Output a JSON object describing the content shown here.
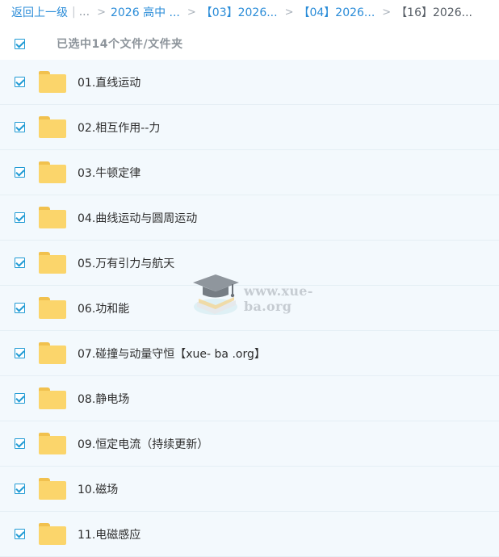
{
  "breadcrumb": {
    "back": "返回上一级",
    "ellipsis": "...",
    "items": [
      "2026 高中 ...",
      "【03】2026...",
      "【04】2026..."
    ],
    "current": "【16】2026..."
  },
  "selection": {
    "all_checked": true,
    "status_text": "已选中14个文件/文件夹"
  },
  "files": [
    {
      "name": "01.直线运动",
      "checked": true
    },
    {
      "name": "02.相互作用--力",
      "checked": true
    },
    {
      "name": "03.牛顿定律",
      "checked": true
    },
    {
      "name": "04.曲线运动与圆周运动",
      "checked": true
    },
    {
      "name": "05.万有引力与航天",
      "checked": true
    },
    {
      "name": "06.功和能",
      "checked": true
    },
    {
      "name": "07.碰撞与动量守恒【xue- ba .org】",
      "checked": true
    },
    {
      "name": "08.静电场",
      "checked": true
    },
    {
      "name": "09.恒定电流（持续更新）",
      "checked": true
    },
    {
      "name": "10.磁场",
      "checked": true
    },
    {
      "name": "11.电磁感应",
      "checked": true
    }
  ],
  "watermark": {
    "text": "www.xue-ba.org"
  },
  "colors": {
    "link": "#2a8cd8",
    "checkbox": "#1f9ad4",
    "row_background": "#f3f9fd",
    "folder": "#fbd56b"
  }
}
